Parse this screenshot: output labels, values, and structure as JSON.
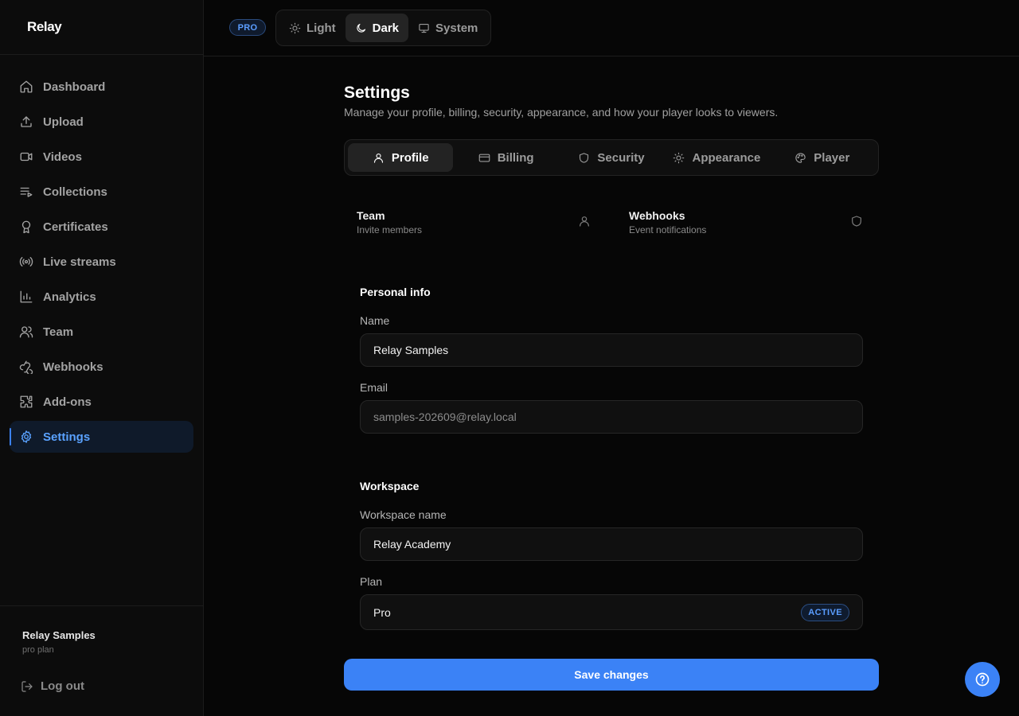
{
  "brand": {
    "name": "Relay"
  },
  "sidebar": {
    "items": [
      {
        "label": "Dashboard",
        "icon": "home-icon"
      },
      {
        "label": "Upload",
        "icon": "upload-icon"
      },
      {
        "label": "Videos",
        "icon": "video-icon"
      },
      {
        "label": "Collections",
        "icon": "collections-icon"
      },
      {
        "label": "Certificates",
        "icon": "certificate-icon"
      },
      {
        "label": "Live streams",
        "icon": "live-stream-icon"
      },
      {
        "label": "Analytics",
        "icon": "analytics-icon"
      },
      {
        "label": "Team",
        "icon": "team-icon"
      },
      {
        "label": "Webhooks",
        "icon": "webhook-icon"
      },
      {
        "label": "Add-ons",
        "icon": "puzzle-icon"
      },
      {
        "label": "Settings",
        "icon": "gear-icon",
        "active": true
      }
    ],
    "user": {
      "name": "Relay Samples",
      "plan": "pro plan"
    },
    "logout_label": "Log out"
  },
  "topbar": {
    "badge": "PRO",
    "theme_options": [
      {
        "label": "Light",
        "icon": "sun-icon"
      },
      {
        "label": "Dark",
        "icon": "moon-icon",
        "active": true
      },
      {
        "label": "System",
        "icon": "monitor-icon"
      }
    ]
  },
  "page": {
    "title": "Settings",
    "subtitle": "Manage your profile, billing, security, appearance, and how your player looks to viewers."
  },
  "tabs": [
    {
      "label": "Profile",
      "icon": "user-icon",
      "active": true
    },
    {
      "label": "Billing",
      "icon": "credit-card-icon"
    },
    {
      "label": "Security",
      "icon": "shield-icon"
    },
    {
      "label": "Appearance",
      "icon": "sun-icon"
    },
    {
      "label": "Player",
      "icon": "palette-icon"
    }
  ],
  "quick_links": [
    {
      "title": "Team",
      "desc": "Invite members",
      "icon": "user-icon"
    },
    {
      "title": "Webhooks",
      "desc": "Event notifications",
      "icon": "shield-icon"
    }
  ],
  "personal_info": {
    "title": "Personal info",
    "name_label": "Name",
    "name_value": "Relay Samples",
    "email_label": "Email",
    "email_value": "samples-202609@relay.local"
  },
  "workspace": {
    "title": "Workspace",
    "name_label": "Workspace name",
    "name_value": "Relay Academy",
    "plan_label": "Plan",
    "plan_value": "Pro",
    "plan_status": "ACTIVE"
  },
  "save_label": "Save changes",
  "colors": {
    "accent": "#3b82f6",
    "background": "#060606",
    "active_text": "#5aa2ff"
  }
}
